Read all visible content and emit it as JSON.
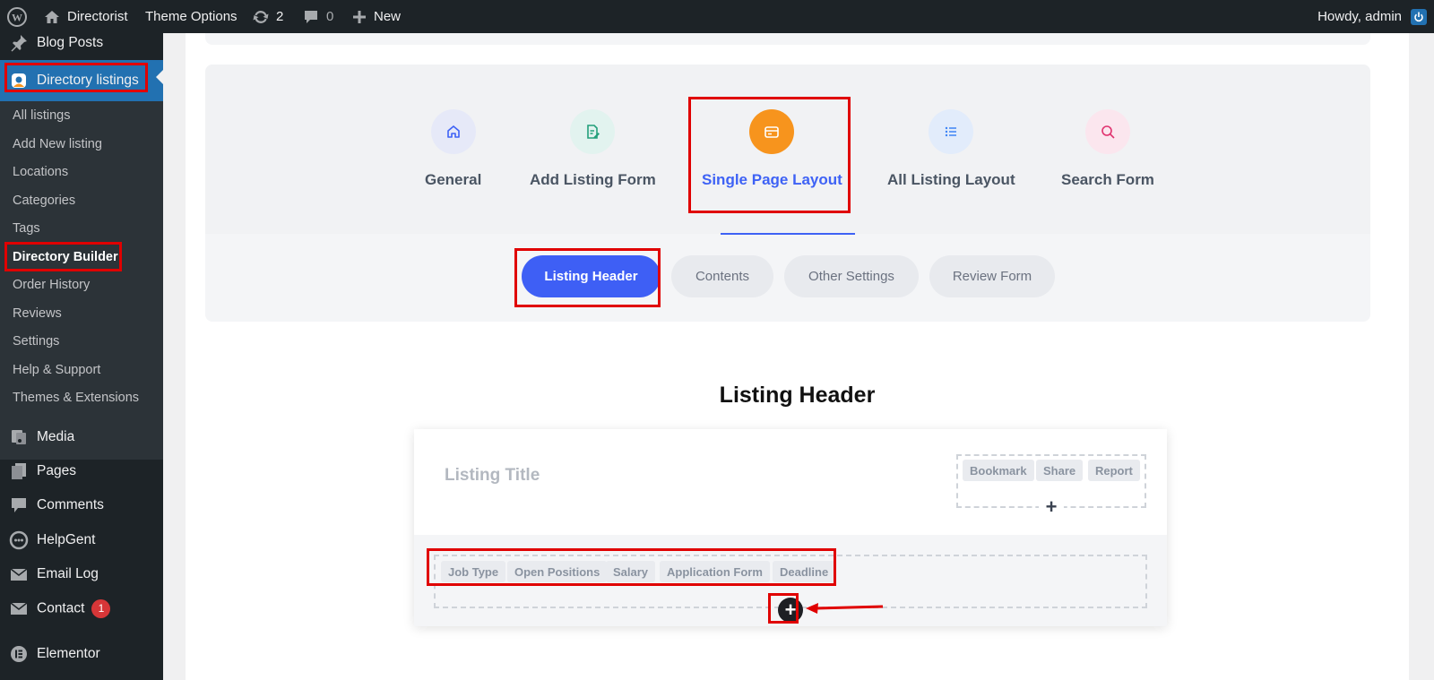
{
  "adminbar": {
    "wp_icon": "wordpress-icon",
    "site_name": "Directorist",
    "theme_options": "Theme Options",
    "updates_count": "2",
    "comments_count": "0",
    "new_label": "New",
    "howdy": "Howdy, admin"
  },
  "sidebar": {
    "blog_posts": "Blog Posts",
    "directory_listings": "Directory listings",
    "sub": {
      "all_listings": "All listings",
      "add_new_listing": "Add New listing",
      "locations": "Locations",
      "categories": "Categories",
      "tags": "Tags",
      "directory_builder": "Directory Builder",
      "order_history": "Order History",
      "reviews": "Reviews",
      "settings": "Settings",
      "help_support": "Help & Support",
      "themes_extensions": "Themes & Extensions"
    },
    "media": "Media",
    "pages": "Pages",
    "comments": "Comments",
    "helpgent": "HelpGent",
    "email_log": "Email Log",
    "contact": "Contact",
    "contact_badge": "1",
    "elementor": "Elementor"
  },
  "builder": {
    "tabs": {
      "general": "General",
      "add_listing_form": "Add Listing Form",
      "single_page_layout": "Single Page Layout",
      "all_listing_layout": "All Listing Layout",
      "search_form": "Search Form"
    },
    "subtabs": {
      "listing_header": "Listing Header",
      "contents": "Contents",
      "other_settings": "Other Settings",
      "review_form": "Review Form"
    },
    "section_title": "Listing Header",
    "card": {
      "listing_title": "Listing Title",
      "actions": {
        "bookmark": "Bookmark",
        "share": "Share",
        "report": "Report"
      },
      "fields": {
        "job_type": "Job Type",
        "open_positions": "Open Positions",
        "salary": "Salary",
        "application_form": "Application Form",
        "deadline": "Deadline"
      },
      "plus": "+"
    }
  },
  "colors": {
    "accent": "#3e62f5",
    "highlight": "#e00000",
    "active_tab_circle": "#f7941d"
  }
}
